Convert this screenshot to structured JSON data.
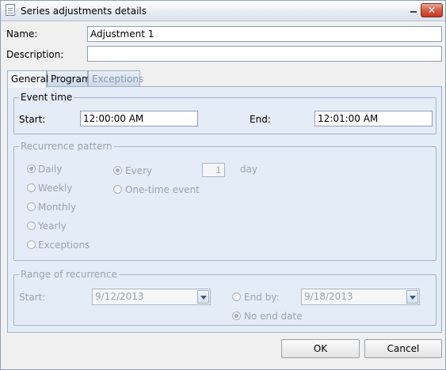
{
  "window": {
    "title": "Series adjustments details"
  },
  "form": {
    "name_label": "Name:",
    "name_value": "Adjustment 1",
    "description_label": "Description:",
    "description_value": ""
  },
  "tabs": [
    {
      "label": "General",
      "state": "active"
    },
    {
      "label": "Program",
      "state": "normal"
    },
    {
      "label": "Exceptions",
      "state": "disabled"
    }
  ],
  "event_time": {
    "legend": "Event time",
    "start_label": "Start:",
    "start_value": "12:00:00 AM",
    "end_label": "End:",
    "end_value": "12:01:00 AM"
  },
  "recurrence": {
    "legend": "Recurrence pattern",
    "options": [
      "Daily",
      "Weekly",
      "Monthly",
      "Yearly",
      "Exceptions"
    ],
    "selected": "Daily",
    "every_label": "Every",
    "every_value": "1",
    "every_unit": "day",
    "one_time_label": "One-time event"
  },
  "range": {
    "legend": "Range of recurrence",
    "start_label": "Start:",
    "start_value": "9/12/2013",
    "end_by_label": "End by:",
    "end_by_value": "9/18/2013",
    "no_end_label": "No end date",
    "selected": "No end date"
  },
  "buttons": {
    "ok": "OK",
    "cancel": "Cancel"
  },
  "icons": {
    "window": "document-icon",
    "minimize": "minimize-icon",
    "close": "close-icon",
    "dropdown": "chevron-down-icon"
  },
  "colors": {
    "panel": "#e4ecf7",
    "close": "#d45c45",
    "disabled_text": "#9aa3ad"
  }
}
